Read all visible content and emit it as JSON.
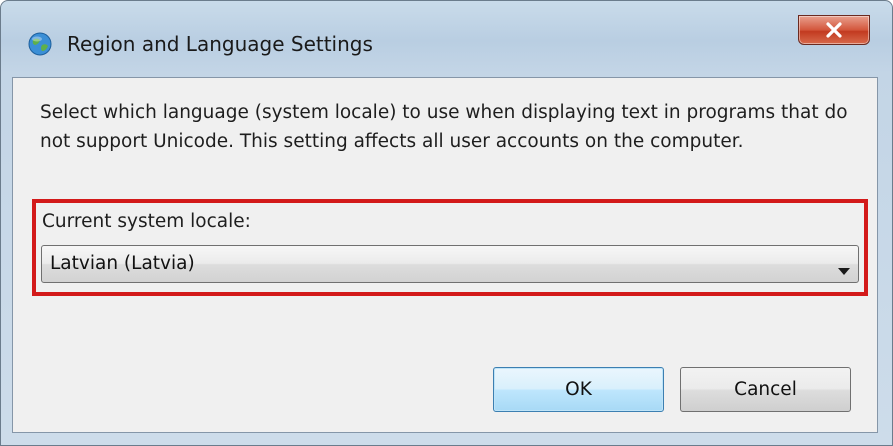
{
  "window": {
    "title": "Region and Language Settings"
  },
  "dialog": {
    "description": "Select which language (system locale) to use when displaying text in programs that do not support Unicode. This setting affects all user accounts on the computer.",
    "locale_label": "Current system locale:",
    "locale_value": "Latvian (Latvia)"
  },
  "buttons": {
    "ok_label": "OK",
    "cancel_label": "Cancel"
  },
  "icons": {
    "title": "globe-icon",
    "close": "close-icon",
    "dropdown": "chevron-down-icon"
  },
  "colors": {
    "highlight": "#d31a1a",
    "close_button": "#c9432a",
    "default_button_border": "#3c7fb1"
  }
}
